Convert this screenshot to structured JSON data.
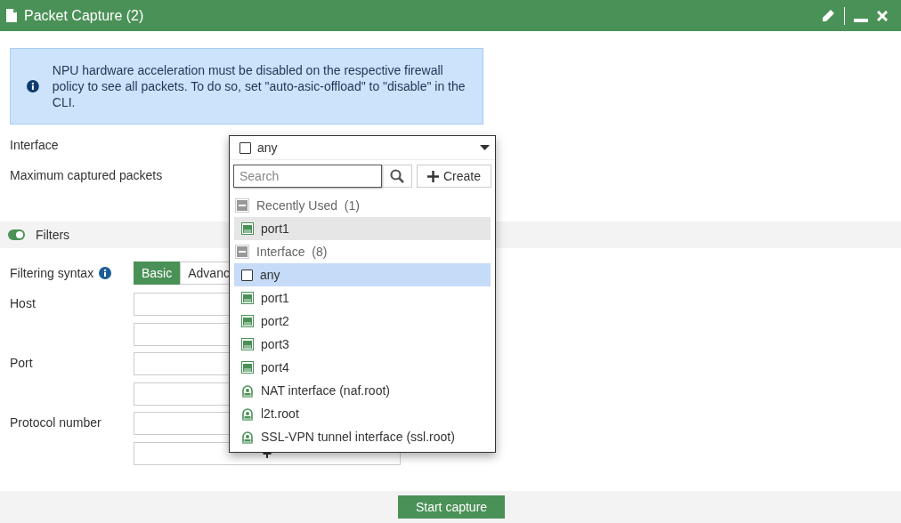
{
  "window": {
    "title": "Packet Capture (2)"
  },
  "notice": "NPU hardware acceleration must be disabled on the respective firewall policy to see all packets. To do so, set \"auto-asic-offload\" to \"disable\" in the CLI.",
  "fields": [
    {
      "label": "Interface"
    },
    {
      "label": "Maximum captured packets"
    }
  ],
  "filters": {
    "label": "Filters",
    "on": true
  },
  "syntax": {
    "label": "Filtering syntax",
    "tabs": [
      {
        "label": "Basic",
        "selected": true
      },
      {
        "label": "Advanc",
        "selected": false
      }
    ]
  },
  "filter_rows": [
    {
      "label": "Host"
    },
    {
      "label": "Port"
    },
    {
      "label": "Protocol number"
    }
  ],
  "add_symbol": "+",
  "dropdown": {
    "value": "any",
    "value_checked": false,
    "search_placeholder": "Search",
    "create_label": "Create",
    "groups": [
      {
        "label": "Recently Used",
        "count": "(1)",
        "expanded": true,
        "items": [
          {
            "label": "port1",
            "kind": "port",
            "selected": false,
            "hovered": true
          }
        ]
      },
      {
        "label": "Interface",
        "count": "(8)",
        "expanded": true,
        "items": [
          {
            "label": "any",
            "kind": "any",
            "checked": false,
            "selected": true,
            "hovered": false
          },
          {
            "label": "port1",
            "kind": "port",
            "selected": false,
            "hovered": false
          },
          {
            "label": "port2",
            "kind": "port",
            "selected": false,
            "hovered": false
          },
          {
            "label": "port3",
            "kind": "port",
            "selected": false,
            "hovered": false
          },
          {
            "label": "port4",
            "kind": "port",
            "selected": false,
            "hovered": false
          },
          {
            "label": "NAT interface (naf.root)",
            "kind": "tunnel",
            "selected": false,
            "hovered": false
          },
          {
            "label": "l2t.root",
            "kind": "tunnel",
            "selected": false,
            "hovered": false
          },
          {
            "label": "SSL-VPN tunnel interface (ssl.root)",
            "kind": "tunnel",
            "selected": false,
            "hovered": false
          }
        ]
      }
    ]
  },
  "start_button": "Start capture"
}
